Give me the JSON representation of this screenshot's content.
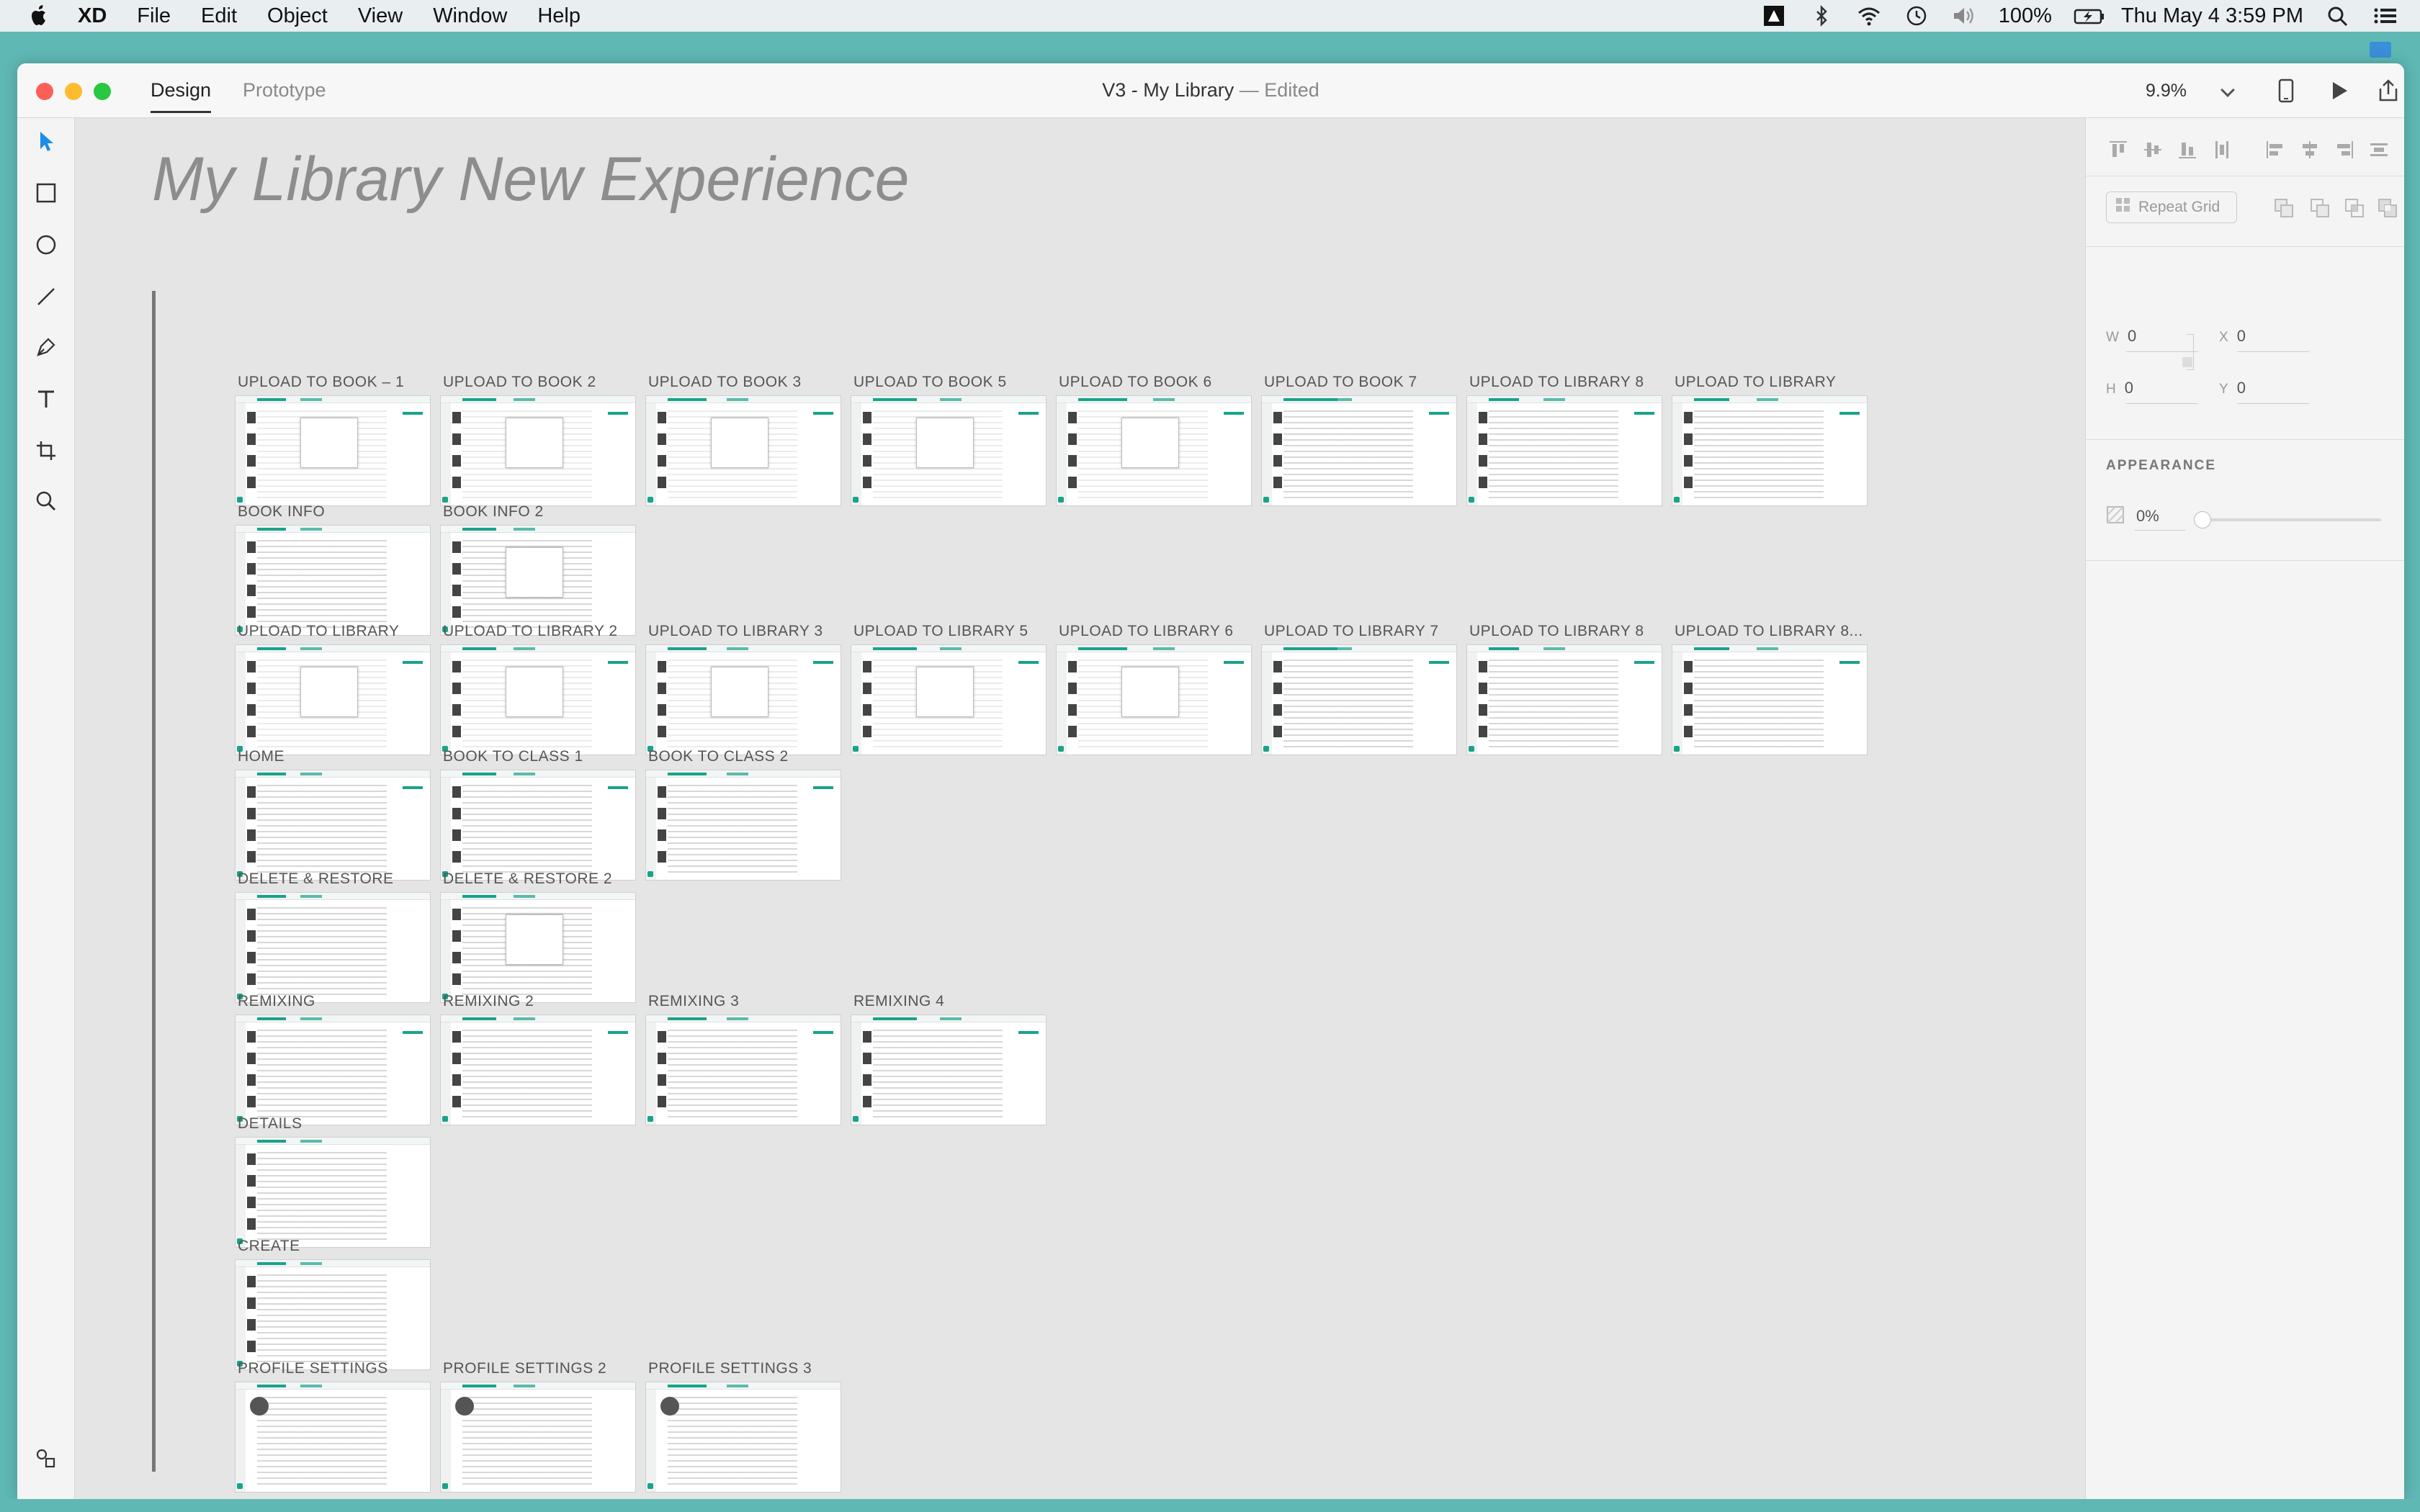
{
  "menubar": {
    "app": "XD",
    "items": [
      "File",
      "Edit",
      "Object",
      "View",
      "Window",
      "Help"
    ],
    "battery": "100%",
    "clock": "Thu May 4  3:59 PM"
  },
  "window": {
    "tabs": [
      "Design",
      "Prototype"
    ],
    "title": "V3 - My Library",
    "status": " — Edited",
    "zoom": "9.9%"
  },
  "canvas": {
    "title": "My Library New Experience",
    "rows": [
      {
        "labels": [
          "UPLOAD TO BOOK – 1",
          "UPLOAD TO BOOK 2",
          "UPLOAD TO BOOK 3",
          "UPLOAD TO BOOK 5",
          "UPLOAD TO BOOK 6",
          "UPLOAD TO BOOK 7",
          "UPLOAD TO LIBRARY 8",
          "UPLOAD TO LIBRARY"
        ]
      },
      {
        "labels": [
          "BOOK INFO",
          "BOOK INFO 2"
        ]
      },
      {
        "labels": [
          "UPLOAD TO LIBRARY",
          "UPLOAD TO LIBRARY 2",
          "UPLOAD TO LIBRARY 3",
          "UPLOAD TO LIBRARY 5",
          "UPLOAD TO LIBRARY 6",
          "UPLOAD TO LIBRARY 7",
          "UPLOAD TO LIBRARY 8",
          "UPLOAD TO LIBRARY 8..."
        ]
      },
      {
        "labels": [
          "HOME",
          "BOOK TO CLASS 1",
          "BOOK TO CLASS 2"
        ]
      },
      {
        "labels": [
          "DELETE & RESTORE",
          "DELETE & RESTORE 2"
        ]
      },
      {
        "labels": [
          "REMIXING",
          "REMIXING 2",
          "REMIXING 3",
          "REMIXING 4"
        ]
      },
      {
        "labels": [
          "DETAILS"
        ]
      },
      {
        "labels": [
          "CREATE"
        ]
      },
      {
        "labels": [
          "PROFILE SETTINGS",
          "PROFILE SETTINGS 2",
          "PROFILE SETTINGS 3"
        ]
      }
    ]
  },
  "panel": {
    "repeat_grid": "Repeat Grid",
    "w_label": "W",
    "w_value": "0",
    "x_label": "X",
    "x_value": "0",
    "h_label": "H",
    "h_value": "0",
    "y_label": "Y",
    "y_value": "0",
    "appearance": "APPEARANCE",
    "opacity": "0%"
  },
  "colors": {
    "accent": "#19a38a",
    "desktop": "#5fb8b4"
  }
}
